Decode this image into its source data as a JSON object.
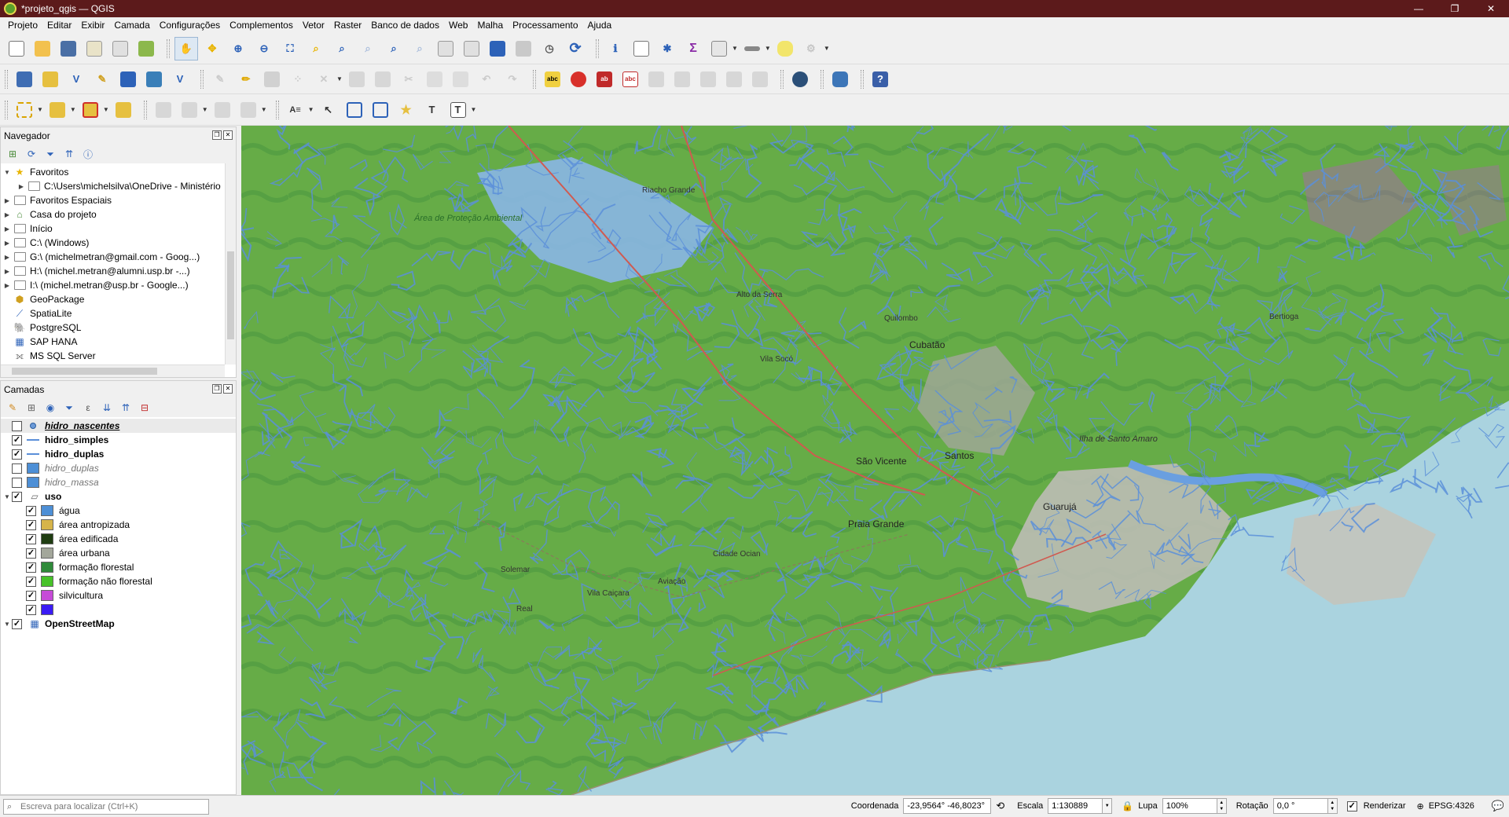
{
  "window": {
    "title": "*projeto_qgis — QGIS",
    "controls": [
      "—",
      "❐",
      "✕"
    ]
  },
  "menu": [
    "Projeto",
    "Editar",
    "Exibir",
    "Camada",
    "Configurações",
    "Complementos",
    "Vetor",
    "Raster",
    "Banco de dados",
    "Web",
    "Malha",
    "Processamento",
    "Ajuda"
  ],
  "browser_panel": {
    "title": "Navegador",
    "items": [
      {
        "label": "Favoritos",
        "icon": "star-icon",
        "expanded": true,
        "indent": 0
      },
      {
        "label": "C:\\Users\\michelsilva\\OneDrive - Ministério",
        "icon": "folder-icon",
        "expanded": false,
        "indent": 1
      },
      {
        "label": "Favoritos Espaciais",
        "icon": "spatial-bookmarks-icon",
        "expanded": false,
        "indent": 0
      },
      {
        "label": "Casa do projeto",
        "icon": "project-home-icon",
        "expanded": false,
        "indent": 0
      },
      {
        "label": "Início",
        "icon": "folder-icon",
        "expanded": false,
        "indent": 0
      },
      {
        "label": "C:\\ (Windows)",
        "icon": "drive-icon",
        "expanded": false,
        "indent": 0
      },
      {
        "label": "G:\\ (michelmetran@gmail.com - Goog...)",
        "icon": "drive-icon",
        "expanded": false,
        "indent": 0
      },
      {
        "label": "H:\\ (michel.metran@alumni.usp.br -...)",
        "icon": "drive-icon",
        "expanded": false,
        "indent": 0
      },
      {
        "label": "I:\\ (michel.metran@usp.br - Google...)",
        "icon": "drive-icon",
        "expanded": false,
        "indent": 0
      },
      {
        "label": "GeoPackage",
        "icon": "geopackage-icon",
        "expanded": null,
        "indent": 0
      },
      {
        "label": "SpatiaLite",
        "icon": "spatialite-icon",
        "expanded": null,
        "indent": 0
      },
      {
        "label": "PostgreSQL",
        "icon": "postgresql-icon",
        "expanded": null,
        "indent": 0
      },
      {
        "label": "SAP HANA",
        "icon": "sap-hana-icon",
        "expanded": null,
        "indent": 0
      },
      {
        "label": "MS SQL Server",
        "icon": "mssql-icon",
        "expanded": null,
        "indent": 0
      }
    ]
  },
  "layers_panel": {
    "title": "Camadas",
    "layers": [
      {
        "label": "hidro_nascentes",
        "checked": false,
        "symbol": "point",
        "style": "bi",
        "indent": 0
      },
      {
        "label": "hidro_simples",
        "checked": true,
        "symbol": "line",
        "style": "bold",
        "indent": 0
      },
      {
        "label": "hidro_duplas",
        "checked": true,
        "symbol": "line",
        "style": "bold",
        "indent": 0
      },
      {
        "label": "hidro_duplas",
        "checked": false,
        "symbol": "fill",
        "color": "#4d8fd6",
        "style": "italic-grey",
        "indent": 0
      },
      {
        "label": "hidro_massa",
        "checked": false,
        "symbol": "fill",
        "color": "#4d8fd6",
        "style": "italic-grey",
        "indent": 0
      },
      {
        "label": "uso",
        "checked": true,
        "symbol": "polygon-group",
        "style": "bold",
        "indent": 0
      },
      {
        "label": "água",
        "checked": true,
        "symbol": "fill",
        "color": "#4d8fd6",
        "style": "",
        "indent": 1
      },
      {
        "label": "área antropizada",
        "checked": true,
        "symbol": "fill",
        "color": "#d6b44a",
        "style": "",
        "indent": 1
      },
      {
        "label": "área edificada",
        "checked": true,
        "symbol": "fill",
        "color": "#1f3d12",
        "style": "",
        "indent": 1
      },
      {
        "label": "área urbana",
        "checked": true,
        "symbol": "fill",
        "color": "#a3a79b",
        "style": "",
        "indent": 1
      },
      {
        "label": "formação florestal",
        "checked": true,
        "symbol": "fill",
        "color": "#2f8a3a",
        "style": "",
        "indent": 1
      },
      {
        "label": "formação não florestal",
        "checked": true,
        "symbol": "fill",
        "color": "#47c229",
        "style": "",
        "indent": 1
      },
      {
        "label": "silvicultura",
        "checked": true,
        "symbol": "fill",
        "color": "#c64bd8",
        "style": "",
        "indent": 1
      },
      {
        "label": "",
        "checked": true,
        "symbol": "fill",
        "color": "#3a1bf5",
        "style": "",
        "indent": 1
      },
      {
        "label": "OpenStreetMap",
        "checked": true,
        "symbol": "raster",
        "style": "bold",
        "indent": 0
      }
    ]
  },
  "map_labels": {
    "cubatao": "Cubatão",
    "santos": "Santos",
    "sao_vicente": "São Vicente",
    "guaruja": "Guarujá",
    "praia_grande": "Praia Grande",
    "bertioga": "Bertioga",
    "ilha_santo_amaro": "Ilha de Santo Amaro",
    "quilombo": "Quilombo",
    "alto_serra": "Alto da Serra",
    "riacho_grande": "Riacho Grande",
    "parque_estadual": "Área de Proteção Ambiental",
    "vila_socó": "Vila Socó",
    "mongagua": "Solemar",
    "vila_caiçara": "Vila Caiçara",
    "aviacao": "Aviação",
    "cidade_ocian": "Cidade Ocian",
    "real": "Real"
  },
  "statusbar": {
    "locator_placeholder": "Escreva para localizar (Ctrl+K)",
    "coord_label": "Coordenada",
    "coord_value": "-23,9564° -46,8023°",
    "scale_label": "Escala",
    "scale_value": "1:130889",
    "magnifier_label": "Lupa",
    "magnifier_value": "100%",
    "rotation_label": "Rotação",
    "rotation_value": "0,0 °",
    "render_label": "Renderizar",
    "crs": "EPSG:4326"
  },
  "colors": {
    "titlebar": "#5c1a1b",
    "forest": "#2f8a3a",
    "nonforest": "#47c229",
    "water": "#4d8fd6",
    "ocean": "#aad3df",
    "urban": "#a3a79b"
  }
}
